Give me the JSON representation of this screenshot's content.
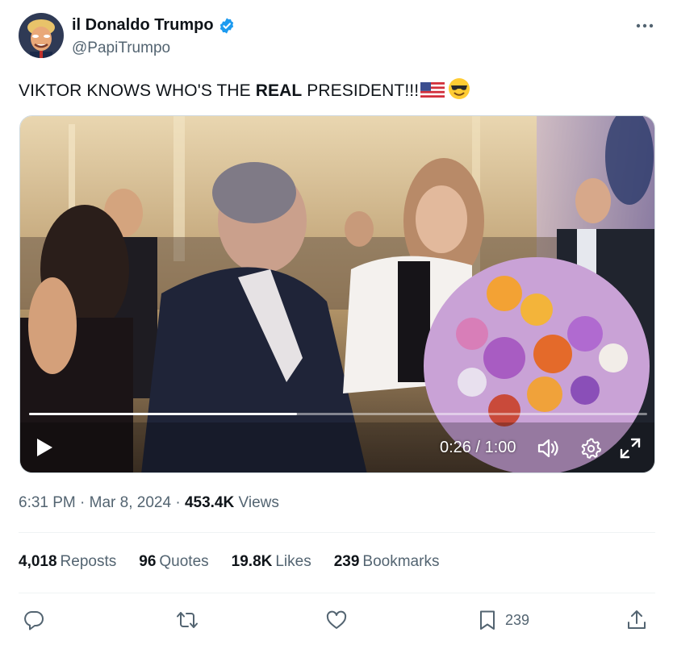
{
  "tweet": {
    "author": {
      "display_name": "il Donaldo Trumpo",
      "handle": "@PapiTrumpo",
      "verified": true,
      "avatar_icon": "avatar-portrait"
    },
    "text": {
      "before": "VIKTOR KNOWS WHO'S THE ",
      "bold": "REAL",
      "after": " PRESIDENT!!!",
      "emojis": [
        "us-flag-emoji",
        "smiling-face-with-sunglasses-emoji"
      ]
    },
    "video": {
      "current_time": "0:26",
      "separator": " / ",
      "duration": "1:00",
      "progress_fraction": 0.433,
      "controls": [
        "play-icon",
        "volume-icon",
        "settings-gear-icon",
        "fullscreen-icon"
      ]
    },
    "meta": {
      "time": "6:31 PM",
      "sep1": " · ",
      "date": "Mar 8, 2024",
      "sep2": " · ",
      "views_count": "453.4K",
      "views_label": " Views"
    },
    "stats": [
      {
        "count": "4,018",
        "label": "Reposts"
      },
      {
        "count": "96",
        "label": "Quotes"
      },
      {
        "count": "19.8K",
        "label": "Likes"
      },
      {
        "count": "239",
        "label": "Bookmarks"
      }
    ],
    "actions": {
      "reply_icon": "reply-icon",
      "repost_icon": "repost-icon",
      "like_icon": "heart-icon",
      "bookmark_icon": "bookmark-icon",
      "bookmark_count": "239",
      "share_icon": "share-icon"
    }
  },
  "colors": {
    "text_primary": "#0f1419",
    "text_secondary": "#536471",
    "verified_blue": "#1d9bf0",
    "divider": "#eff3f4"
  }
}
